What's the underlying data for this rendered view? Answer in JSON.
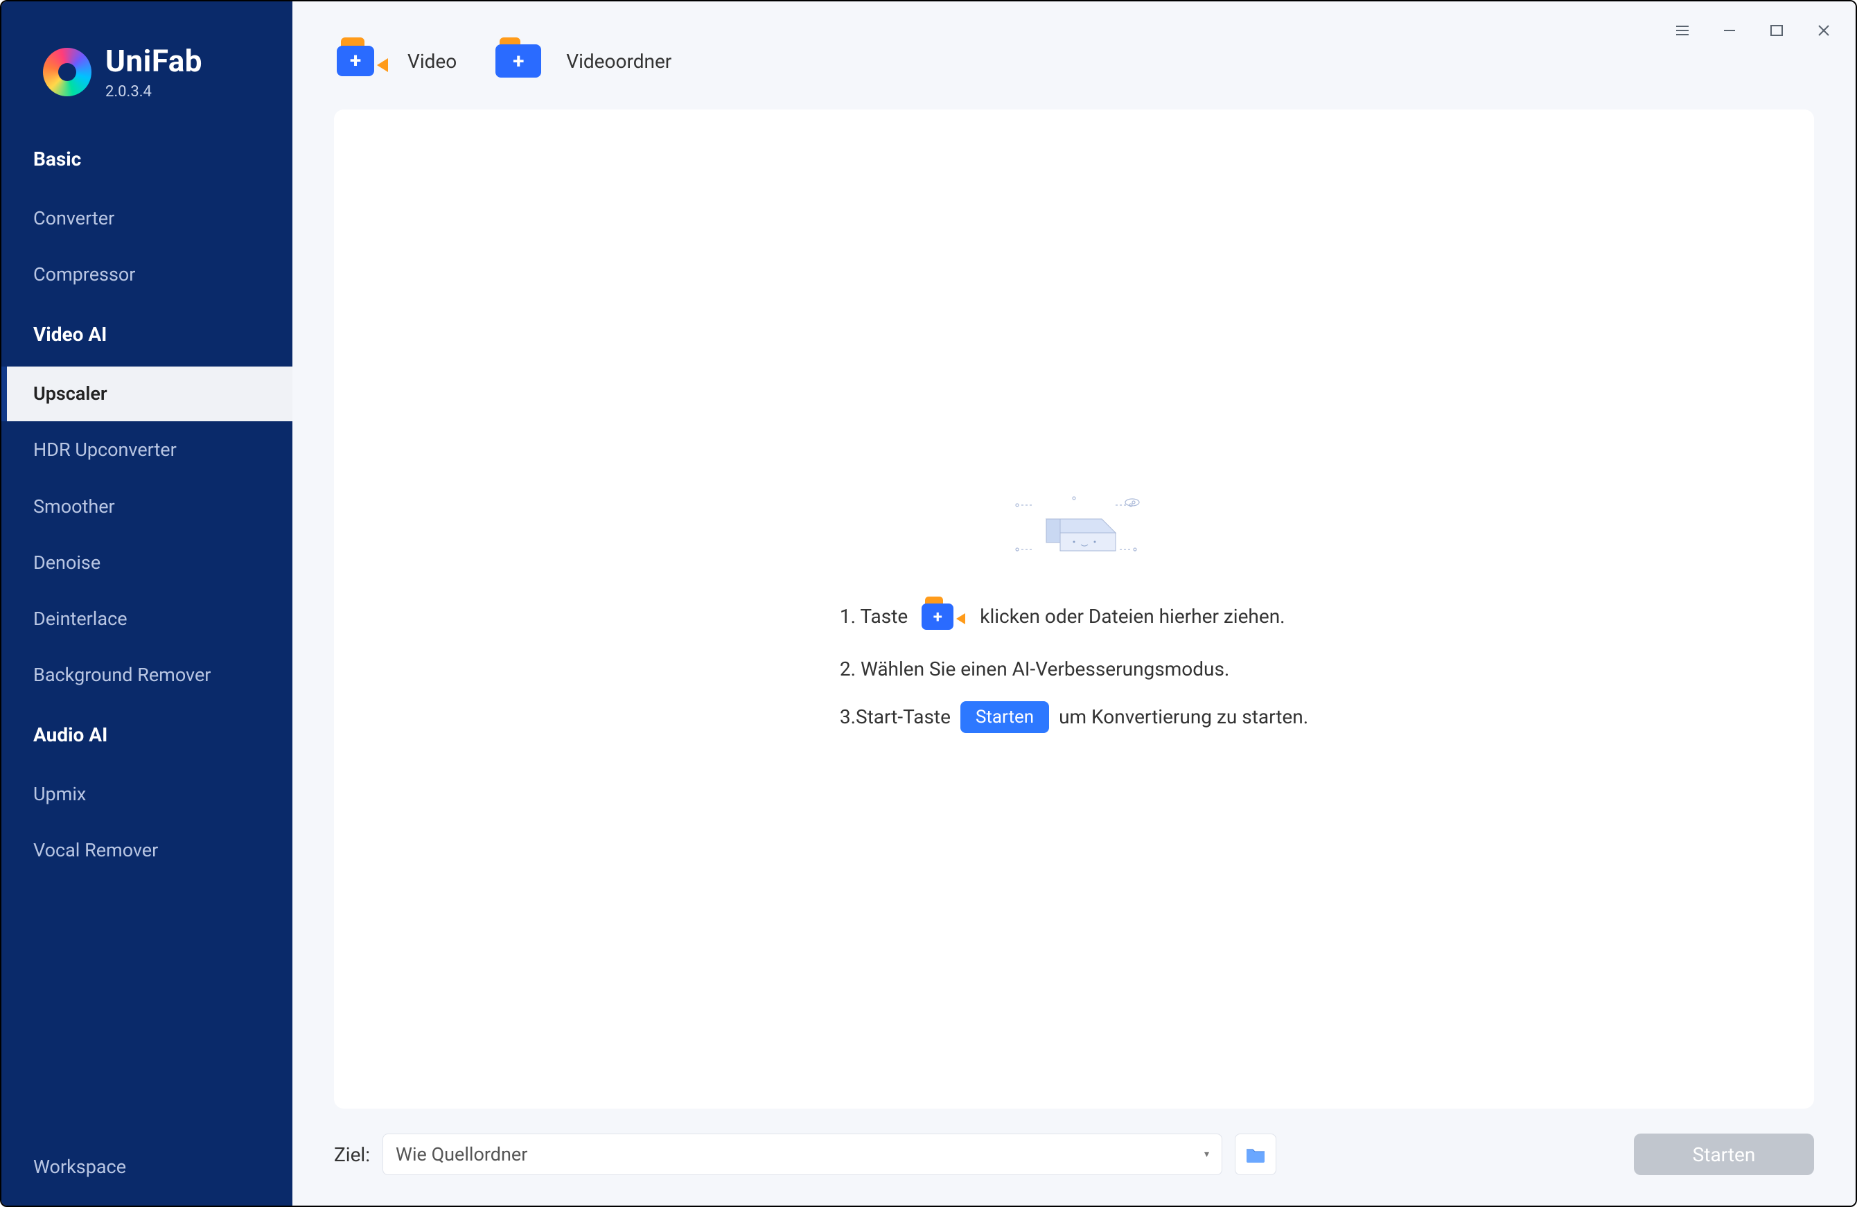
{
  "brand": {
    "name": "UniFab",
    "version": "2.0.3.4"
  },
  "sidebar": {
    "sections": [
      {
        "title": "Basic",
        "items": [
          {
            "label": "Converter"
          },
          {
            "label": "Compressor"
          }
        ]
      },
      {
        "title": "Video AI",
        "items": [
          {
            "label": "Upscaler",
            "active": true
          },
          {
            "label": "HDR Upconverter"
          },
          {
            "label": "Smoother"
          },
          {
            "label": "Denoise"
          },
          {
            "label": "Deinterlace"
          },
          {
            "label": "Background Remover"
          }
        ]
      },
      {
        "title": "Audio AI",
        "items": [
          {
            "label": "Upmix"
          },
          {
            "label": "Vocal Remover"
          }
        ]
      }
    ],
    "workspace": "Workspace"
  },
  "topbar": {
    "add_video_label": "Video",
    "add_folder_label": "Videoordner"
  },
  "content": {
    "step1_prefix": "1. Taste",
    "step1_suffix": "klicken oder Dateien hierher ziehen.",
    "step2": "2. Wählen Sie einen AI-Verbesserungsmodus.",
    "step3_prefix": "3.Start-Taste",
    "step3_chip": "Starten",
    "step3_suffix": "um Konvertierung zu starten."
  },
  "bottombar": {
    "dest_label": "Ziel:",
    "dest_value": "Wie Quellordner",
    "start_label": "Starten"
  }
}
